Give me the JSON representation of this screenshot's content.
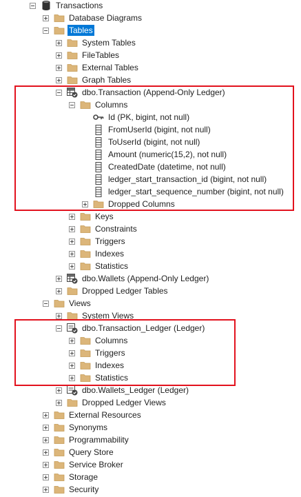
{
  "annotation_color": "#e2111d",
  "selection_color": "#0078d7",
  "tree": [
    {
      "label": "Transactions",
      "icon": "database-icon",
      "expander": "minus",
      "indent": 0
    },
    {
      "label": "Database Diagrams",
      "icon": "folder-icon",
      "expander": "plus",
      "indent": 1
    },
    {
      "label": "Tables",
      "icon": "folder-icon",
      "expander": "minus",
      "indent": 1,
      "selected": true
    },
    {
      "label": "System Tables",
      "icon": "folder-icon",
      "expander": "plus",
      "indent": 2
    },
    {
      "label": "FileTables",
      "icon": "folder-icon",
      "expander": "plus",
      "indent": 2
    },
    {
      "label": "External Tables",
      "icon": "folder-icon",
      "expander": "plus",
      "indent": 2
    },
    {
      "label": "Graph Tables",
      "icon": "folder-icon",
      "expander": "plus",
      "indent": 2
    },
    {
      "label": "dbo.Transaction (Append-Only Ledger)",
      "icon": "ledger-table-icon",
      "expander": "minus",
      "indent": 2
    },
    {
      "label": "Columns",
      "icon": "folder-icon",
      "expander": "minus",
      "indent": 3
    },
    {
      "label": "Id (PK, bigint, not null)",
      "icon": "key-icon",
      "expander": "none",
      "indent": 4
    },
    {
      "label": "FromUserId (bigint, not null)",
      "icon": "column-icon",
      "expander": "none",
      "indent": 4
    },
    {
      "label": "ToUserId (bigint, not null)",
      "icon": "column-icon",
      "expander": "none",
      "indent": 4
    },
    {
      "label": "Amount (numeric(15,2), not null)",
      "icon": "column-icon",
      "expander": "none",
      "indent": 4
    },
    {
      "label": "CreatedDate (datetime, not null)",
      "icon": "column-icon",
      "expander": "none",
      "indent": 4
    },
    {
      "label": "ledger_start_transaction_id (bigint, not null)",
      "icon": "column-icon",
      "expander": "none",
      "indent": 4
    },
    {
      "label": "ledger_start_sequence_number (bigint, not null)",
      "icon": "column-icon",
      "expander": "none",
      "indent": 4
    },
    {
      "label": "Dropped Columns",
      "icon": "folder-icon",
      "expander": "plus",
      "indent": 4
    },
    {
      "label": "Keys",
      "icon": "folder-icon",
      "expander": "plus",
      "indent": 3
    },
    {
      "label": "Constraints",
      "icon": "folder-icon",
      "expander": "plus",
      "indent": 3
    },
    {
      "label": "Triggers",
      "icon": "folder-icon",
      "expander": "plus",
      "indent": 3
    },
    {
      "label": "Indexes",
      "icon": "folder-icon",
      "expander": "plus",
      "indent": 3
    },
    {
      "label": "Statistics",
      "icon": "folder-icon",
      "expander": "plus",
      "indent": 3
    },
    {
      "label": "dbo.Wallets (Append-Only Ledger)",
      "icon": "ledger-table-icon",
      "expander": "plus",
      "indent": 2
    },
    {
      "label": "Dropped Ledger Tables",
      "icon": "folder-icon",
      "expander": "plus",
      "indent": 2
    },
    {
      "label": "Views",
      "icon": "folder-icon",
      "expander": "minus",
      "indent": 1
    },
    {
      "label": "System Views",
      "icon": "folder-icon",
      "expander": "plus",
      "indent": 2
    },
    {
      "label": "dbo.Transaction_Ledger (Ledger)",
      "icon": "ledger-view-icon",
      "expander": "minus",
      "indent": 2
    },
    {
      "label": "Columns",
      "icon": "folder-icon",
      "expander": "plus",
      "indent": 3
    },
    {
      "label": "Triggers",
      "icon": "folder-icon",
      "expander": "plus",
      "indent": 3
    },
    {
      "label": "Indexes",
      "icon": "folder-icon",
      "expander": "plus",
      "indent": 3
    },
    {
      "label": "Statistics",
      "icon": "folder-icon",
      "expander": "plus",
      "indent": 3
    },
    {
      "label": "dbo.Wallets_Ledger (Ledger)",
      "icon": "ledger-view-icon",
      "expander": "plus",
      "indent": 2
    },
    {
      "label": "Dropped Ledger Views",
      "icon": "folder-icon",
      "expander": "plus",
      "indent": 2
    },
    {
      "label": "External Resources",
      "icon": "folder-icon",
      "expander": "plus",
      "indent": 1
    },
    {
      "label": "Synonyms",
      "icon": "folder-icon",
      "expander": "plus",
      "indent": 1
    },
    {
      "label": "Programmability",
      "icon": "folder-icon",
      "expander": "plus",
      "indent": 1
    },
    {
      "label": "Query Store",
      "icon": "folder-icon",
      "expander": "plus",
      "indent": 1
    },
    {
      "label": "Service Broker",
      "icon": "folder-icon",
      "expander": "plus",
      "indent": 1
    },
    {
      "label": "Storage",
      "icon": "folder-icon",
      "expander": "plus",
      "indent": 1
    },
    {
      "label": "Security",
      "icon": "folder-icon",
      "expander": "plus",
      "indent": 1
    }
  ]
}
